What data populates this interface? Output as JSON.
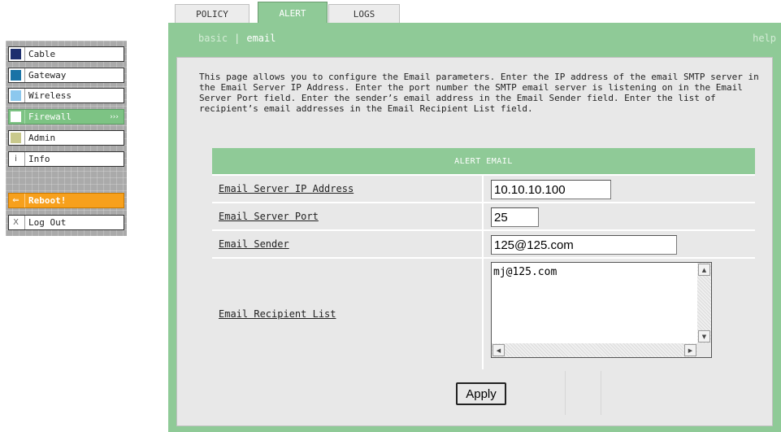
{
  "tabs": [
    {
      "label": "POLICY",
      "active": false
    },
    {
      "label": "ALERT",
      "active": true
    },
    {
      "label": "LOGS",
      "active": false
    }
  ],
  "sidebar": {
    "items": [
      {
        "label": "Cable",
        "icon": "square-dark-blue",
        "color": "#1d2f6e"
      },
      {
        "label": "Gateway",
        "icon": "square-teal",
        "color": "#1973a6"
      },
      {
        "label": "Wireless",
        "icon": "square-light-blue",
        "color": "#8cc8ee"
      },
      {
        "label": "Firewall",
        "icon": "square-white",
        "active": true,
        "arrow": "›››"
      },
      {
        "label": "Admin",
        "icon": "square-khaki",
        "color": "#c9c98c"
      },
      {
        "label": "Info",
        "icon": "info-icon",
        "glyph": "i"
      },
      {
        "label": "Reboot!",
        "icon": "reboot-icon",
        "glyph": "⇐"
      },
      {
        "label": "Log Out",
        "icon": "close-icon",
        "glyph": "X"
      }
    ]
  },
  "subnav": {
    "basic": "basic",
    "separator": "|",
    "current": "email",
    "help": "help"
  },
  "description": "This page allows you to configure the Email parameters. Enter the IP address of the email SMTP server in the Email Server IP Address. Enter the port number the SMTP email server is listening on in the Email Server Port field. Enter the sender’s email address in the Email Sender field. Enter the list of recipient’s email addresses in the Email Recipient List field.",
  "form": {
    "title": "ALERT EMAIL",
    "server_ip": {
      "label": "Email Server IP Address",
      "value": "10.10.10.100"
    },
    "server_port": {
      "label": "Email Server Port",
      "value": "25"
    },
    "sender": {
      "label": "Email Sender",
      "value": "125@125.com"
    },
    "recipients": {
      "label": "Email Recipient List",
      "value": "mj@125.com"
    },
    "apply_label": "Apply"
  },
  "colors": {
    "accent_green": "#8fca97",
    "reboot_orange": "#f7a01c"
  }
}
